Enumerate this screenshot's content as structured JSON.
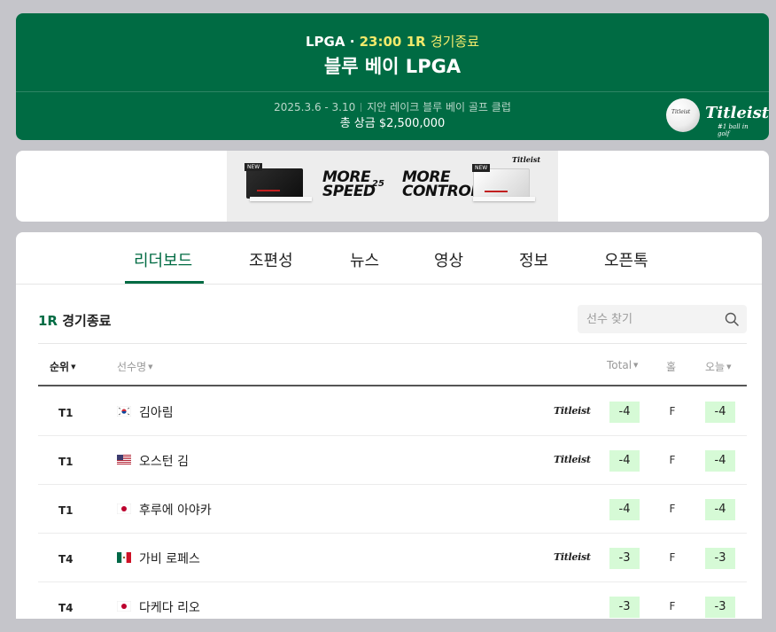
{
  "header": {
    "tour": "LPGA",
    "time": "23:00",
    "round_status": "1R",
    "status": "경기종료",
    "title": "블루 베이 LPGA",
    "dates": "2025.3.6 - 3.10",
    "venue": "지안 레이크 블루 베이 골프 클럽",
    "purse": "총 상금 $2,500,000",
    "sponsor_logo": "Titleist",
    "sponsor_tagline": "#1 ball in golf",
    "colors": {
      "background": "#006b43",
      "accent": "#f2ea6b"
    }
  },
  "banner": {
    "left_text_1": "MORE",
    "left_text_2": "SPEED",
    "middle": "25",
    "right_text_1": "MORE",
    "right_text_2": "CONTROL",
    "badge": "NEW",
    "logo": "Titleist"
  },
  "tabs": [
    {
      "label": "리더보드",
      "active": true
    },
    {
      "label": "조편성"
    },
    {
      "label": "뉴스"
    },
    {
      "label": "영상"
    },
    {
      "label": "정보"
    },
    {
      "label": "오픈톡"
    }
  ],
  "round_label": {
    "round": "1R",
    "status": "경기종료"
  },
  "search": {
    "placeholder": "선수 찾기",
    "icon": "search-icon"
  },
  "columns": {
    "rank": "순위",
    "player": "선수명",
    "total": "Total",
    "hole": "홀",
    "today": "오늘"
  },
  "rows": [
    {
      "rank": "T1",
      "flag": "kr",
      "name": "김아림",
      "sponsor": "Titleist",
      "total": "-4",
      "hole": "F",
      "today": "-4"
    },
    {
      "rank": "T1",
      "flag": "us",
      "name": "오스턴 김",
      "sponsor": "Titleist",
      "total": "-4",
      "hole": "F",
      "today": "-4"
    },
    {
      "rank": "T1",
      "flag": "jp",
      "name": "후루에 아야카",
      "sponsor": "",
      "total": "-4",
      "hole": "F",
      "today": "-4"
    },
    {
      "rank": "T4",
      "flag": "mx",
      "name": "가비 로페스",
      "sponsor": "Titleist",
      "total": "-3",
      "hole": "F",
      "today": "-3"
    },
    {
      "rank": "T4",
      "flag": "jp",
      "name": "다케다 리오",
      "sponsor": "",
      "total": "-3",
      "hole": "F",
      "today": "-3"
    }
  ],
  "colors": {
    "brand": "#006b43",
    "score_bg": "#d6fad6"
  }
}
